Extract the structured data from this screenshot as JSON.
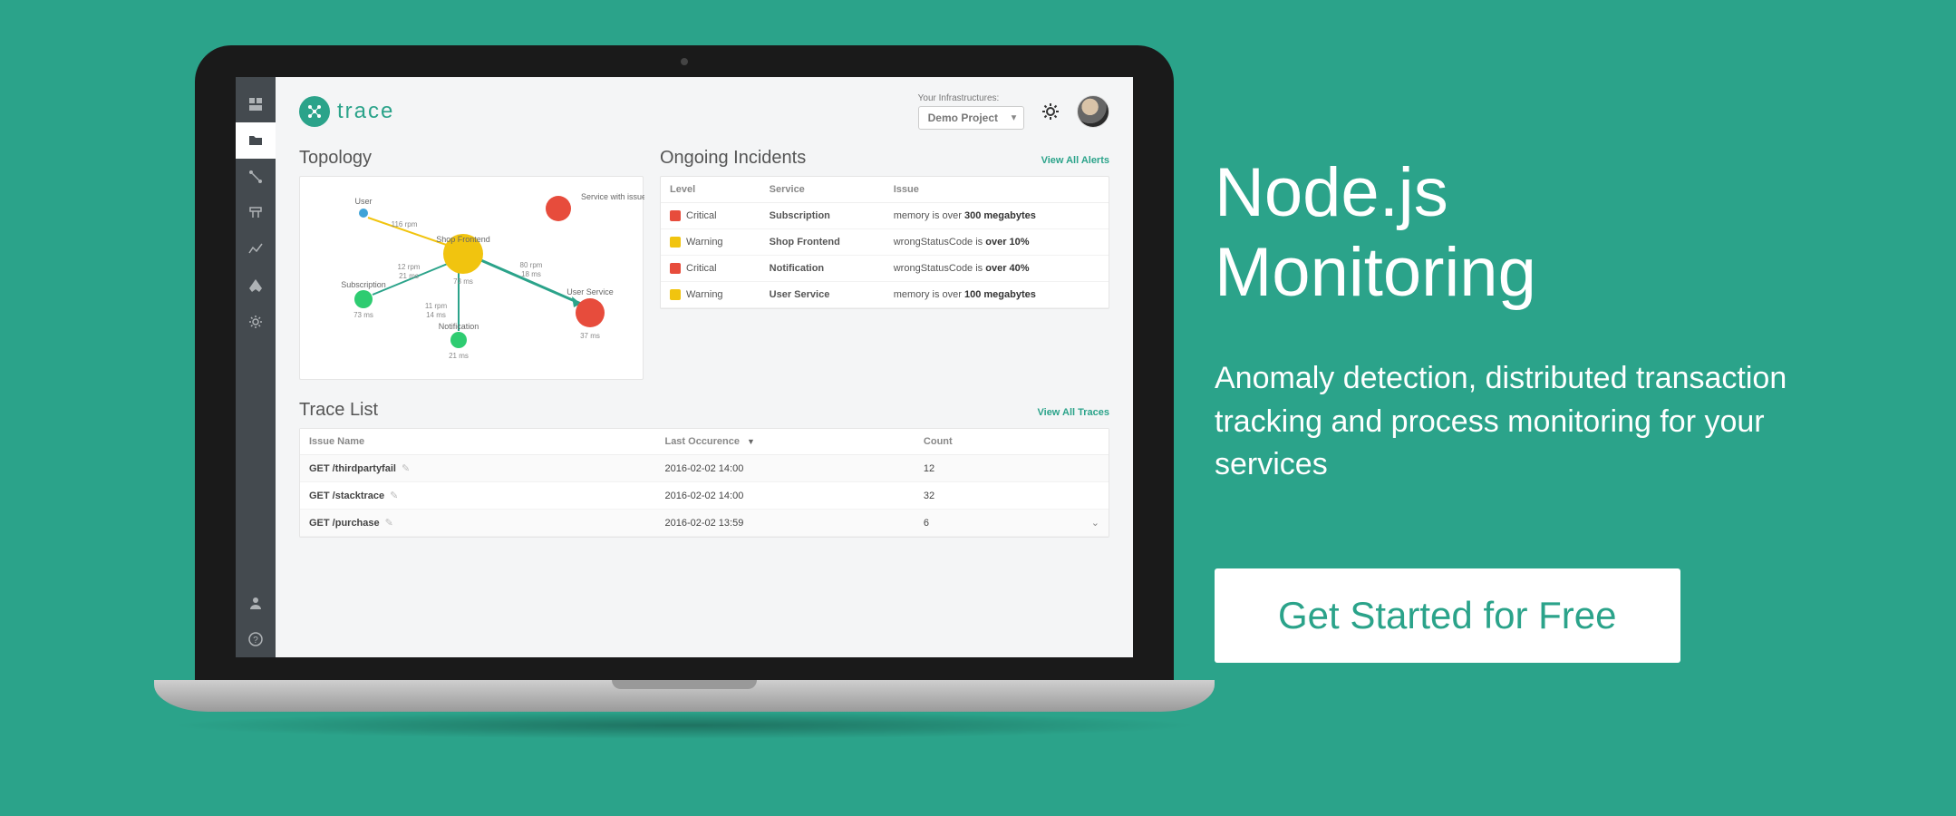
{
  "marketing": {
    "title_line1": "Node.js",
    "title_line2": "Monitoring",
    "subtitle": "Anomaly detection, distributed transaction tracking and process monitoring for your services",
    "cta": "Get Started for Free"
  },
  "logo": {
    "text": "trace"
  },
  "header": {
    "infra_label": "Your Infrastructures:",
    "infra_selected": "Demo Project"
  },
  "topology": {
    "title": "Topology",
    "nodes": {
      "user": "User",
      "shop_frontend": "Shop Frontend",
      "subscription": "Subscription",
      "notification": "Notification",
      "user_service": "User Service",
      "service_with_issue": "Service with issue"
    },
    "edges": {
      "user_shop": "116 rpm",
      "shop_metric": "73 ms",
      "shop_sub_top": "12 rpm",
      "shop_sub_bot": "21 ms",
      "sub_metric": "73 ms",
      "shop_notif_top": "11 rpm",
      "shop_notif_bot": "14 ms",
      "notif_metric": "21 ms",
      "shop_user_top": "80 rpm",
      "shop_user_bot": "18 ms",
      "user_metric": "37 ms"
    }
  },
  "incidents": {
    "title": "Ongoing Incidents",
    "view_all": "View All Alerts",
    "cols": {
      "level": "Level",
      "service": "Service",
      "issue": "Issue"
    },
    "rows": [
      {
        "sev": "crit",
        "level": "Critical",
        "service": "Subscription",
        "issue_pre": "memory is over ",
        "issue_b": "300 megabytes",
        "issue_post": ""
      },
      {
        "sev": "warn",
        "level": "Warning",
        "service": "Shop Frontend",
        "issue_pre": "wrongStatusCode is ",
        "issue_b": "over 10%",
        "issue_post": ""
      },
      {
        "sev": "crit",
        "level": "Critical",
        "service": "Notification",
        "issue_pre": "wrongStatusCode is ",
        "issue_b": "over 40%",
        "issue_post": ""
      },
      {
        "sev": "warn",
        "level": "Warning",
        "service": "User Service",
        "issue_pre": "memory is over ",
        "issue_b": "100 megabytes",
        "issue_post": ""
      }
    ]
  },
  "traces": {
    "title": "Trace List",
    "view_all": "View All Traces",
    "cols": {
      "name": "Issue Name",
      "last": "Last Occurence",
      "count": "Count"
    },
    "rows": [
      {
        "name": "GET /thirdpartyfail",
        "last": "2016-02-02 14:00",
        "count": "12"
      },
      {
        "name": "GET /stacktrace",
        "last": "2016-02-02 14:00",
        "count": "32"
      },
      {
        "name": "GET /purchase",
        "last": "2016-02-02 13:59",
        "count": "6"
      }
    ]
  }
}
